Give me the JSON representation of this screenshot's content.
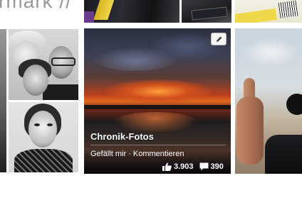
{
  "header": {
    "title_fragment": "rmark //"
  },
  "featured_album": {
    "title": "Chronik-Fotos",
    "like_action": "Gefällt mir",
    "separator": " · ",
    "comment_action": "Kommentieren",
    "like_count": "3.903",
    "comment_count": "390",
    "edit_icon": "pencil-icon",
    "like_icon": "thumbs-up-icon",
    "comment_icon": "speech-bubble-icon"
  },
  "colors": {
    "overlay_text": "#ffffff",
    "edit_button_bg": "#f4f4f4",
    "page_bg": "#ffffff",
    "title_gray": "#9a9a9a"
  }
}
